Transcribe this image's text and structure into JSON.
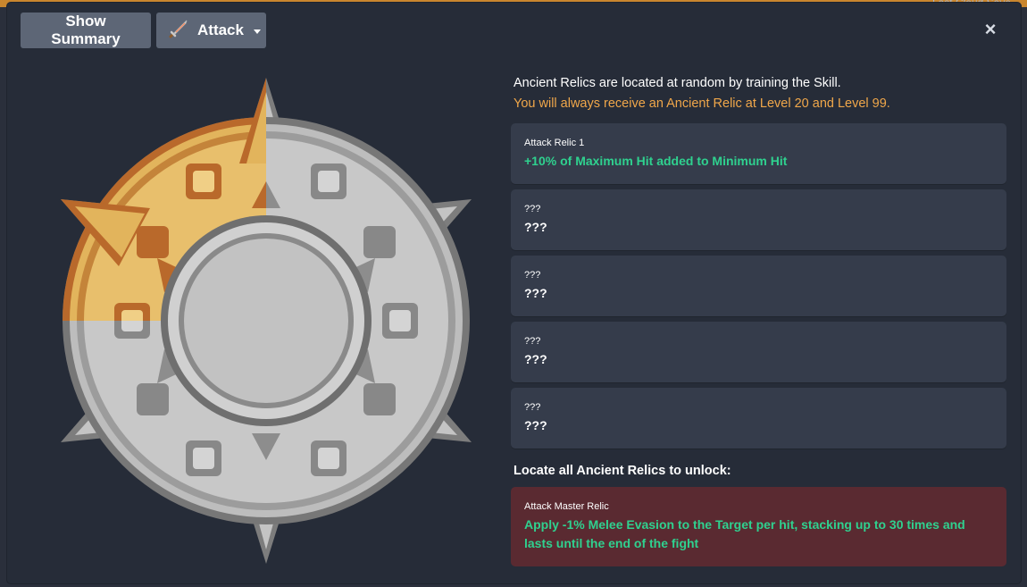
{
  "background": {
    "cloud_save_text": "Last Cloud Save"
  },
  "header": {
    "summary_button_label": "Show Summary",
    "skill_dropdown": {
      "label": "Attack",
      "icon": "sword-icon"
    },
    "close_label": "×"
  },
  "info": {
    "line_1": "Ancient Relics are located at random by training the Skill.",
    "line_2": "You will always receive an Ancient Relic at Level 20 and Level 99."
  },
  "relics": [
    {
      "name": "Attack Relic 1",
      "description": "+10% of Maximum Hit added to Minimum Hit",
      "unlocked": true
    },
    {
      "name": "???",
      "description": "???",
      "unlocked": false
    },
    {
      "name": "???",
      "description": "???",
      "unlocked": false
    },
    {
      "name": "???",
      "description": "???",
      "unlocked": false
    },
    {
      "name": "???",
      "description": "???",
      "unlocked": false
    }
  ],
  "master": {
    "section_title": "Locate all Ancient Relics to unlock:",
    "name": "Attack Master Relic",
    "description": "Apply -1% Melee Evasion to the Target per hit, stacking up to 30 times and lasts until the end of the fight"
  },
  "emblem": {
    "progress_fraction": 0.2,
    "colors": {
      "gold": "#e2b45c",
      "gold_dark": "#b9692b",
      "silver": "#c7c7c7",
      "silver_dark": "#7a7a7a",
      "success_text": "#2fd18f",
      "warning_text": "#f0a74a",
      "master_bg": "#5a2a31"
    }
  }
}
